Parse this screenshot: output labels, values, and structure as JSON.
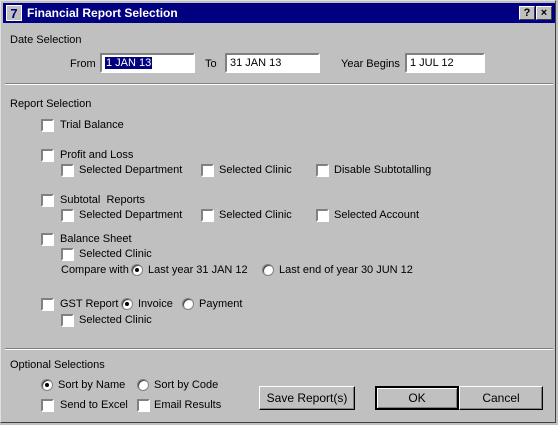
{
  "window": {
    "title": "Financial Report Selection",
    "icon_glyph": "7",
    "help_label": "?",
    "close_label": "×"
  },
  "date_selection": {
    "heading": "Date Selection",
    "from_label": "From",
    "from_value": "1 JAN 13",
    "to_label": "To",
    "to_value": "31 JAN 13",
    "year_begins_label": "Year Begins",
    "year_begins_value": "1 JUL 12"
  },
  "report_selection": {
    "heading": "Report Selection",
    "trial_balance": "Trial Balance",
    "profit_and_loss": "Profit and Loss",
    "pl_selected_department": "Selected Department",
    "pl_selected_clinic": "Selected Clinic",
    "pl_disable_subtotalling": "Disable Subtotalling",
    "subtotal_reports": "Subtotal  Reports",
    "st_selected_department": "Selected Department",
    "st_selected_clinic": "Selected Clinic",
    "st_selected_account": "Selected Account",
    "balance_sheet": "Balance Sheet",
    "bs_selected_clinic": "Selected Clinic",
    "compare_with": "Compare with",
    "last_year": "Last year 31 JAN 12",
    "last_end_of_year": "Last end of year 30 JUN 12",
    "gst_report": "GST Report",
    "invoice": "Invoice",
    "payment": "Payment",
    "gst_selected_clinic": "Selected Clinic"
  },
  "optional_selections": {
    "heading": "Optional Selections",
    "sort_by_name": "Sort by Name",
    "sort_by_code": "Sort by Code",
    "send_to_excel": "Send to Excel",
    "email_results": "Email Results"
  },
  "buttons": {
    "save_reports": "Save Report(s)",
    "ok": "OK",
    "cancel": "Cancel"
  }
}
